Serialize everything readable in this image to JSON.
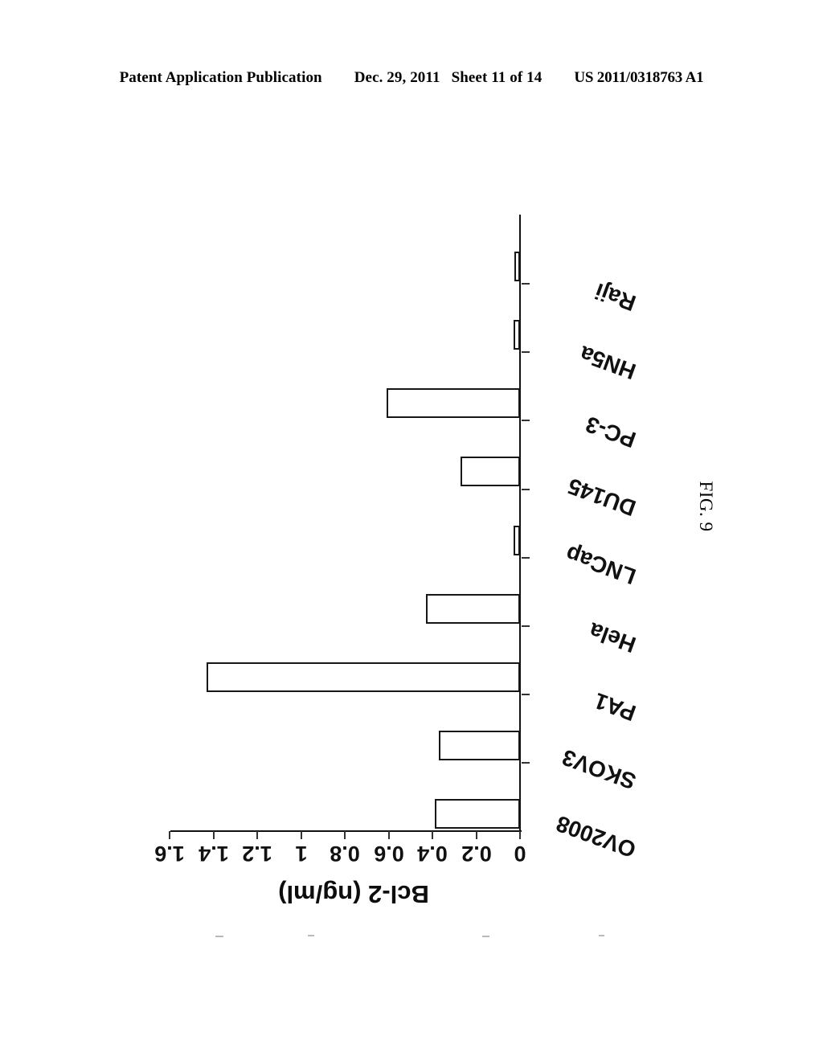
{
  "header": {
    "publication": "Patent Application Publication",
    "date": "Dec. 29, 2011",
    "sheet": "Sheet 11 of 14",
    "number": "US 2011/0318763 A1"
  },
  "figure": {
    "caption": "FIG. 9"
  },
  "chart_data": {
    "type": "bar",
    "orientation": "horizontal",
    "title": "",
    "xlabel": "",
    "ylabel": "Bcl-2 (ng/ml)",
    "value_axis_title": "Bcl-2 (ng/ml)",
    "grid": false,
    "legend": false,
    "rotated_180": true,
    "ylim": [
      0,
      1.6
    ],
    "tick_labels": [
      "0",
      "0.2",
      "0.4",
      "0.6",
      "0.8",
      "1",
      "1.2",
      "1.4",
      "1.6"
    ],
    "tick_values": [
      0,
      0.2,
      0.4,
      0.6,
      0.8,
      1,
      1.2,
      1.4,
      1.6
    ],
    "categories": [
      "OV2008",
      "SKOV3",
      "PA1",
      "Hela",
      "LNCap",
      "DU145",
      "PC-3",
      "HN5a",
      "Raji"
    ],
    "values": [
      0.39,
      0.37,
      1.43,
      0.43,
      0.03,
      0.27,
      0.61,
      0.03,
      0.025
    ],
    "bars": [
      {
        "label": "OV2008",
        "value": 0.39
      },
      {
        "label": "SKOV3",
        "value": 0.37
      },
      {
        "label": "PA1",
        "value": 1.43
      },
      {
        "label": "Hela",
        "value": 0.43
      },
      {
        "label": "LNCap",
        "value": 0.03
      },
      {
        "label": "DU145",
        "value": 0.27
      },
      {
        "label": "PC-3",
        "value": 0.61
      },
      {
        "label": "HN5a",
        "value": 0.03
      },
      {
        "label": "Raji",
        "value": 0.025
      }
    ],
    "colors": {
      "bar_fill": "#ffffff",
      "bar_stroke": "#161616",
      "axis": "#111111"
    }
  }
}
